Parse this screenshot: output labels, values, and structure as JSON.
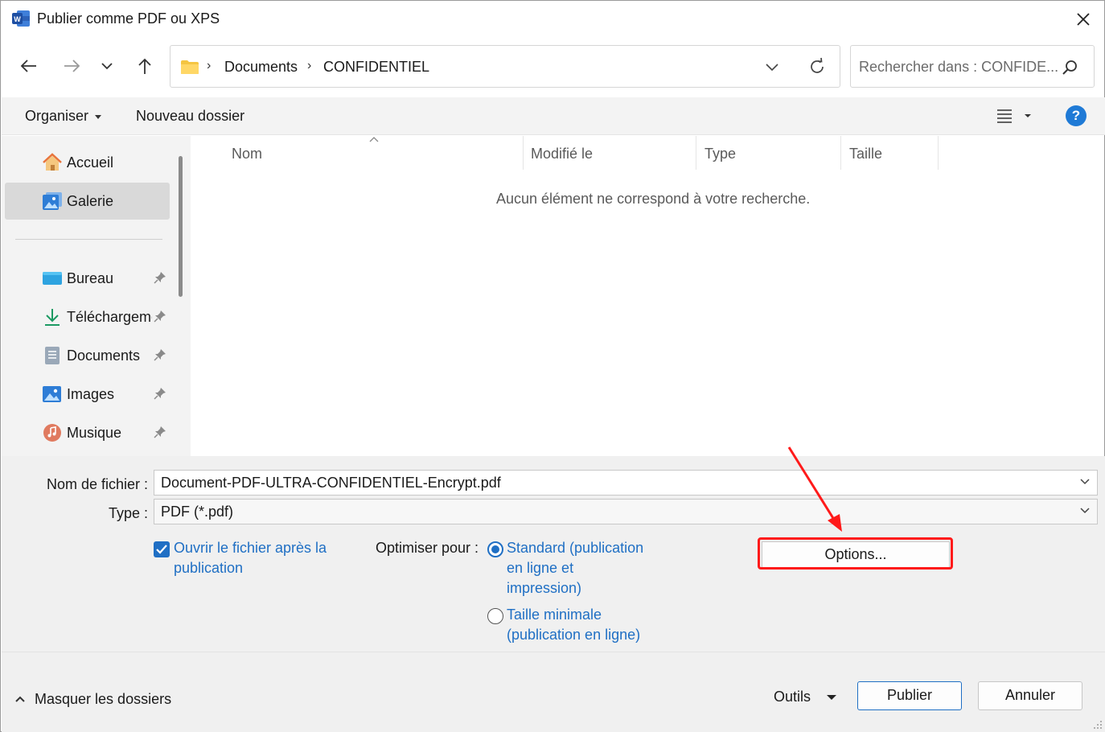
{
  "window": {
    "title": "Publier comme PDF ou XPS"
  },
  "nav": {
    "breadcrumbs": [
      "Documents",
      "CONFIDENTIEL"
    ],
    "search_placeholder": "Rechercher dans : CONFIDE..."
  },
  "toolbar": {
    "organize": "Organiser",
    "new_folder": "Nouveau dossier",
    "help": "?"
  },
  "sidebar": {
    "home": "Accueil",
    "gallery": "Galerie",
    "quick": [
      {
        "label": "Bureau",
        "icon": "desktop-icon"
      },
      {
        "label": "Téléchargements",
        "icon": "download-icon"
      },
      {
        "label": "Documents",
        "icon": "documents-icon"
      },
      {
        "label": "Images",
        "icon": "images-icon"
      },
      {
        "label": "Musique",
        "icon": "music-icon"
      }
    ]
  },
  "list": {
    "columns": [
      "Nom",
      "Modifié le",
      "Type",
      "Taille"
    ],
    "empty_message": "Aucun élément ne correspond à votre recherche."
  },
  "form": {
    "filename_label": "Nom de fichier :",
    "filename": "Document-PDF-ULTRA-CONFIDENTIEL-Encrypt.pdf",
    "type_label": "Type :",
    "type": "PDF (*.pdf)",
    "open_after_line1": "Ouvrir le fichier après la",
    "open_after_line2": "publication",
    "open_after_checked": true,
    "optimize_label": "Optimiser pour :",
    "standard_line1": "Standard (publication",
    "standard_line2": "en ligne et",
    "standard_line3": "impression)",
    "minimal_line1": "Taille minimale",
    "minimal_line2": "(publication en ligne)",
    "options_button": "Options..."
  },
  "footer": {
    "hide_folders": "Masquer les dossiers",
    "tools": "Outils",
    "publish": "Publier",
    "cancel": "Annuler"
  },
  "colors": {
    "accent": "#1f6fc4",
    "highlight": "#ff1a1a"
  }
}
